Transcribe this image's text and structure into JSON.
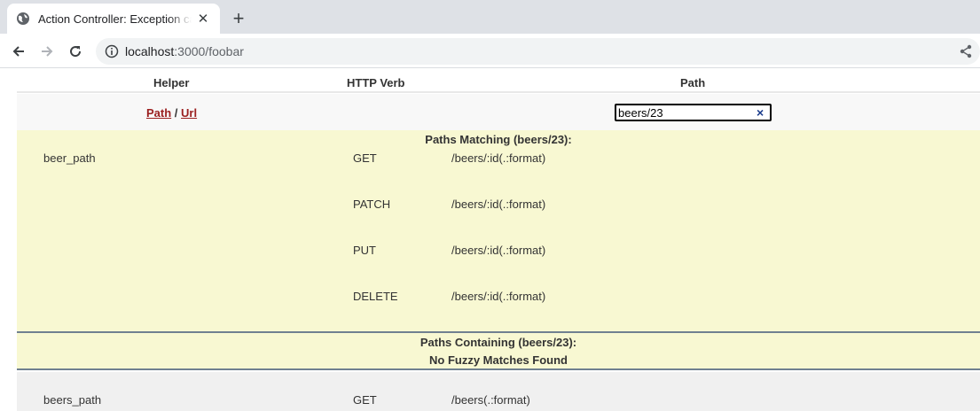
{
  "browser": {
    "tab_title": "Action Controller: Exception caught",
    "url_host": "localhost",
    "url_path": ":3000/foobar"
  },
  "table": {
    "headers": {
      "helper": "Helper",
      "verb": "HTTP Verb",
      "path": "Path"
    },
    "links": {
      "path_label": "Path",
      "separator": " / ",
      "url_label": "Url"
    },
    "search": {
      "value": "beers/23",
      "clear": "×"
    }
  },
  "matching": {
    "title": "Paths Matching (beers/23):",
    "rows": [
      {
        "helper": "beer_path",
        "verb": "GET",
        "path": "/beers/:id(.:format)"
      },
      {
        "helper": "",
        "verb": "PATCH",
        "path": "/beers/:id(.:format)"
      },
      {
        "helper": "",
        "verb": "PUT",
        "path": "/beers/:id(.:format)"
      },
      {
        "helper": "",
        "verb": "DELETE",
        "path": "/beers/:id(.:format)"
      }
    ]
  },
  "fuzzy": {
    "title": "Paths Containing (beers/23):",
    "message": "No Fuzzy Matches Found"
  },
  "routes": [
    {
      "helper": "beers_path",
      "verb": "GET",
      "path": "/beers(.:format)"
    }
  ]
}
